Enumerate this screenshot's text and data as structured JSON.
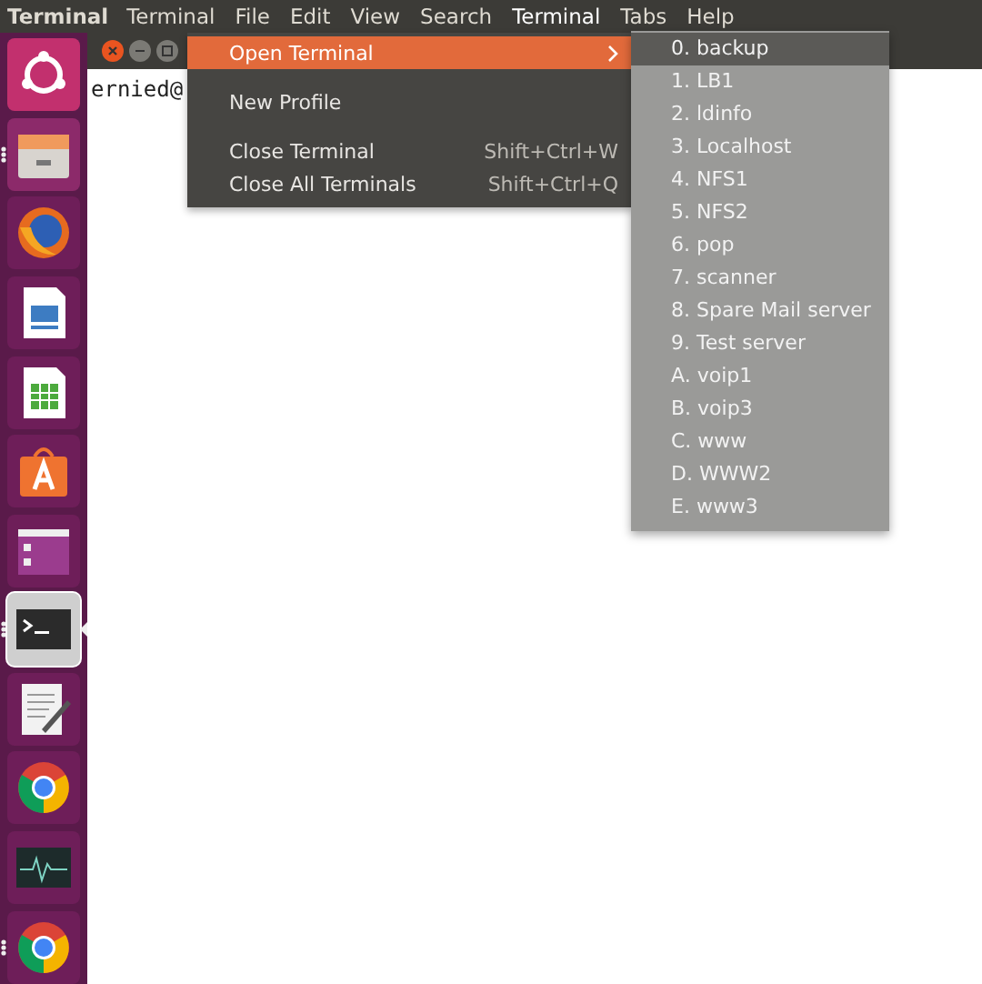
{
  "top_panel": {
    "app_name": "Terminal",
    "menus": [
      {
        "label": "Terminal",
        "selected": false
      },
      {
        "label": "File",
        "selected": false
      },
      {
        "label": "Edit",
        "selected": false
      },
      {
        "label": "View",
        "selected": false
      },
      {
        "label": "Search",
        "selected": false
      },
      {
        "label": "Terminal",
        "selected": true
      },
      {
        "label": "Tabs",
        "selected": false
      },
      {
        "label": "Help",
        "selected": false
      }
    ]
  },
  "launcher": [
    {
      "kind": "ubuntu",
      "running": false,
      "focused": false
    },
    {
      "kind": "files",
      "running": true,
      "focused": false
    },
    {
      "kind": "firefox",
      "running": false,
      "focused": false
    },
    {
      "kind": "impress",
      "running": false,
      "focused": false
    },
    {
      "kind": "calc",
      "running": false,
      "focused": false
    },
    {
      "kind": "software",
      "running": false,
      "focused": false
    },
    {
      "kind": "window",
      "running": false,
      "focused": false
    },
    {
      "kind": "terminal",
      "running": true,
      "focused": true
    },
    {
      "kind": "editor",
      "running": false,
      "focused": false
    },
    {
      "kind": "chrome",
      "running": false,
      "focused": false
    },
    {
      "kind": "monitor",
      "running": false,
      "focused": false
    },
    {
      "kind": "chrome",
      "running": true,
      "focused": false
    }
  ],
  "terminal": {
    "prompt": "ernied@"
  },
  "menu": [
    {
      "kind": "submenu",
      "label": "Open Terminal",
      "selected": true
    },
    {
      "kind": "separator"
    },
    {
      "kind": "item",
      "label": "New Profile",
      "selected": false
    },
    {
      "kind": "separator"
    },
    {
      "kind": "item",
      "label": "Close Terminal",
      "shortcut": "Shift+Ctrl+W",
      "selected": false
    },
    {
      "kind": "item",
      "label": "Close All Terminals",
      "shortcut": "Shift+Ctrl+Q",
      "selected": false
    }
  ],
  "submenu": [
    {
      "label": "0. backup",
      "selected": true
    },
    {
      "label": "1. LB1",
      "selected": false
    },
    {
      "label": "2. ldinfo",
      "selected": false
    },
    {
      "label": "3. Localhost",
      "selected": false
    },
    {
      "label": "4. NFS1",
      "selected": false
    },
    {
      "label": "5. NFS2",
      "selected": false
    },
    {
      "label": "6. pop",
      "selected": false
    },
    {
      "label": "7. scanner",
      "selected": false
    },
    {
      "label": "8. Spare Mail server",
      "selected": false
    },
    {
      "label": "9. Test server",
      "selected": false
    },
    {
      "label": "A. voip1",
      "selected": false
    },
    {
      "label": "B. voip3",
      "selected": false
    },
    {
      "label": "C. www",
      "selected": false
    },
    {
      "label": "D. WWW2",
      "selected": false
    },
    {
      "label": "E. www3",
      "selected": false
    }
  ]
}
